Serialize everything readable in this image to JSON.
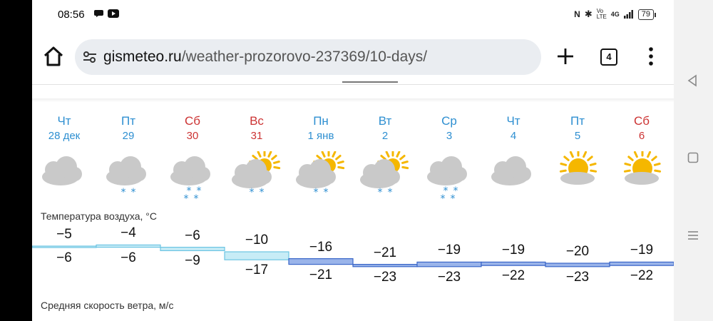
{
  "status": {
    "time": "08:56",
    "network": "4G",
    "battery": "79",
    "volte": "Vo LTE"
  },
  "browser": {
    "url_host": "gismeteo.ru",
    "url_path": "/weather-prozorovo-237369/10-days/",
    "tab_count": "4"
  },
  "labels": {
    "temperature": "Температура воздуха, °C",
    "wind": "Средняя скорость ветра, м/с"
  },
  "days": [
    {
      "dow": "Чт",
      "date": "28 дек",
      "weekend": false,
      "icon": "cloudy-icon",
      "precip": "none",
      "max": "−5",
      "min": "−6"
    },
    {
      "dow": "Пт",
      "date": "29",
      "weekend": false,
      "icon": "cloudy-snow-icon",
      "precip": "light",
      "max": "−4",
      "min": "−6"
    },
    {
      "dow": "Сб",
      "date": "30",
      "weekend": true,
      "icon": "cloudy-snow-icon",
      "precip": "moderate",
      "max": "−6",
      "min": "−9"
    },
    {
      "dow": "Вс",
      "date": "31",
      "weekend": true,
      "icon": "partly-cloudy-snow-icon",
      "precip": "light",
      "max": "−10",
      "min": "−17"
    },
    {
      "dow": "Пн",
      "date": "1 янв",
      "weekend": false,
      "icon": "partly-cloudy-snow-icon",
      "precip": "light",
      "max": "−16",
      "min": "−21"
    },
    {
      "dow": "Вт",
      "date": "2",
      "weekend": false,
      "icon": "partly-cloudy-snow-icon",
      "precip": "light",
      "max": "−21",
      "min": "−23"
    },
    {
      "dow": "Ср",
      "date": "3",
      "weekend": false,
      "icon": "cloudy-snow-icon",
      "precip": "moderate",
      "max": "−19",
      "min": "−23"
    },
    {
      "dow": "Чт",
      "date": "4",
      "weekend": false,
      "icon": "cloudy-icon",
      "precip": "none",
      "max": "−19",
      "min": "−22"
    },
    {
      "dow": "Пт",
      "date": "5",
      "weekend": false,
      "icon": "sun-cloud-icon",
      "precip": "none",
      "max": "−20",
      "min": "−23"
    },
    {
      "dow": "Сб",
      "date": "6",
      "weekend": true,
      "icon": "sun-cloud-icon",
      "precip": "none",
      "max": "−19",
      "min": "−22"
    }
  ],
  "colors": {
    "weekday": "#2e8fd1",
    "weekend": "#cc3333",
    "band_warm": "#c7ecf6",
    "band_cold": "#9ab4ea",
    "band_line": "#3a66c8"
  }
}
